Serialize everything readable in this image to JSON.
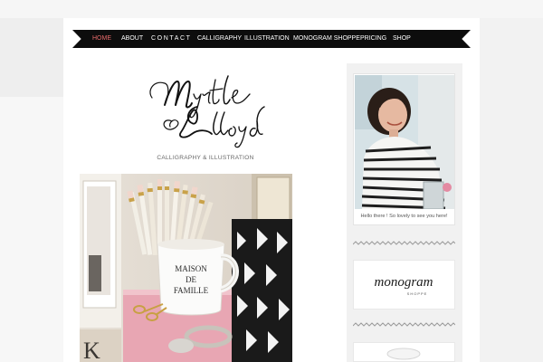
{
  "nav": {
    "items": [
      {
        "label": "HOME",
        "active": true
      },
      {
        "label": "ABOUT",
        "active": false
      },
      {
        "label": "CONTACT",
        "active": false
      },
      {
        "label": "CALLIGRAPHY",
        "active": false
      },
      {
        "label": "ILLUSTRATION",
        "active": false
      },
      {
        "label": "MONOGRAM SHOPPE",
        "active": false
      },
      {
        "label": "PRICING",
        "active": false
      },
      {
        "label": "SHOP",
        "active": false
      }
    ]
  },
  "header": {
    "logo_text": "Myrtle & Lloyd",
    "tagline": "CALLIGRAPHY & ILLUSTRATION"
  },
  "hero": {
    "mug_text": "MAISON DE FAMILLE"
  },
  "sidebar": {
    "profile_caption": "Hello there ! So lovely to see you here!",
    "monogram_text": "monogram",
    "monogram_sub": "SHOPPE"
  },
  "colors": {
    "nav_bg": "#0d0d0d",
    "nav_active": "#e86a6a",
    "page_bg": "#f2f2f2"
  }
}
